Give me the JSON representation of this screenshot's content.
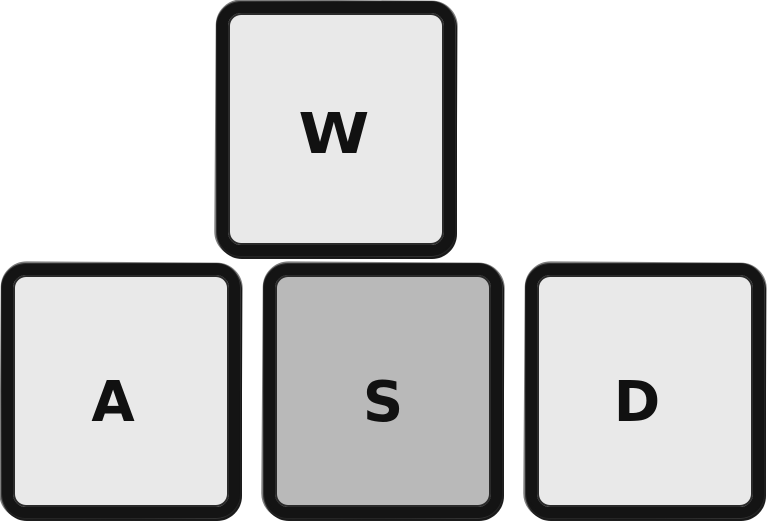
{
  "keys": {
    "w": {
      "label": "W",
      "pressed": false
    },
    "a": {
      "label": "A",
      "pressed": false
    },
    "s": {
      "label": "S",
      "pressed": true
    },
    "d": {
      "label": "D",
      "pressed": false
    }
  },
  "colors": {
    "key_fill": "#e9e9e9",
    "key_pressed_fill": "#b9b9b9",
    "key_border": "#141414",
    "label": "#111111",
    "background": "#ffffff"
  }
}
